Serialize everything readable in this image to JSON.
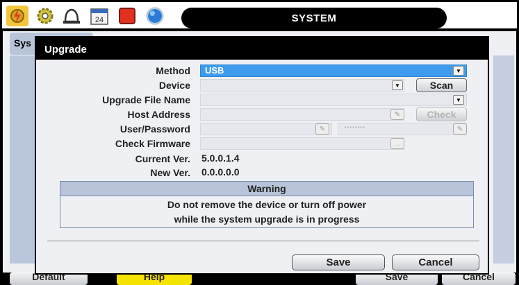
{
  "header": {
    "title": "SYSTEM",
    "icons": [
      "lightning-gear-icon",
      "gear-icon",
      "bell-icon",
      "calendar-icon",
      "record-icon",
      "network-globe-icon"
    ],
    "calendar_number": "24"
  },
  "background": {
    "tab_label": "Sys",
    "bottom_buttons": [
      "Default",
      "Help",
      "Save",
      "Cancel"
    ]
  },
  "dialog": {
    "title": "Upgrade",
    "fields": {
      "method_label": "Method",
      "method_value": "USB",
      "device_label": "Device",
      "device_scan_button": "Scan",
      "file_name_label": "Upgrade File Name",
      "host_address_label": "Host Address",
      "host_check_button": "Check",
      "user_password_label": "User/Password",
      "password_mask": "********",
      "check_firmware_label": "Check Firmware",
      "current_ver_label": "Current Ver.",
      "current_ver_value": "5.0.0.1.4",
      "new_ver_label": "New Ver.",
      "new_ver_value": "0.0.0.0.0"
    },
    "warning": {
      "heading": "Warning",
      "line1": "Do not remove the device or turn off power",
      "line2": "while the system upgrade is in progress"
    },
    "buttons": {
      "save": "Save",
      "cancel": "Cancel"
    }
  },
  "colors": {
    "selected_field": "#3e9bee",
    "title_bar": "#000000",
    "panel": "#eef0f4",
    "warning_header": "#b9c4da",
    "help_button": "#f5e400"
  }
}
